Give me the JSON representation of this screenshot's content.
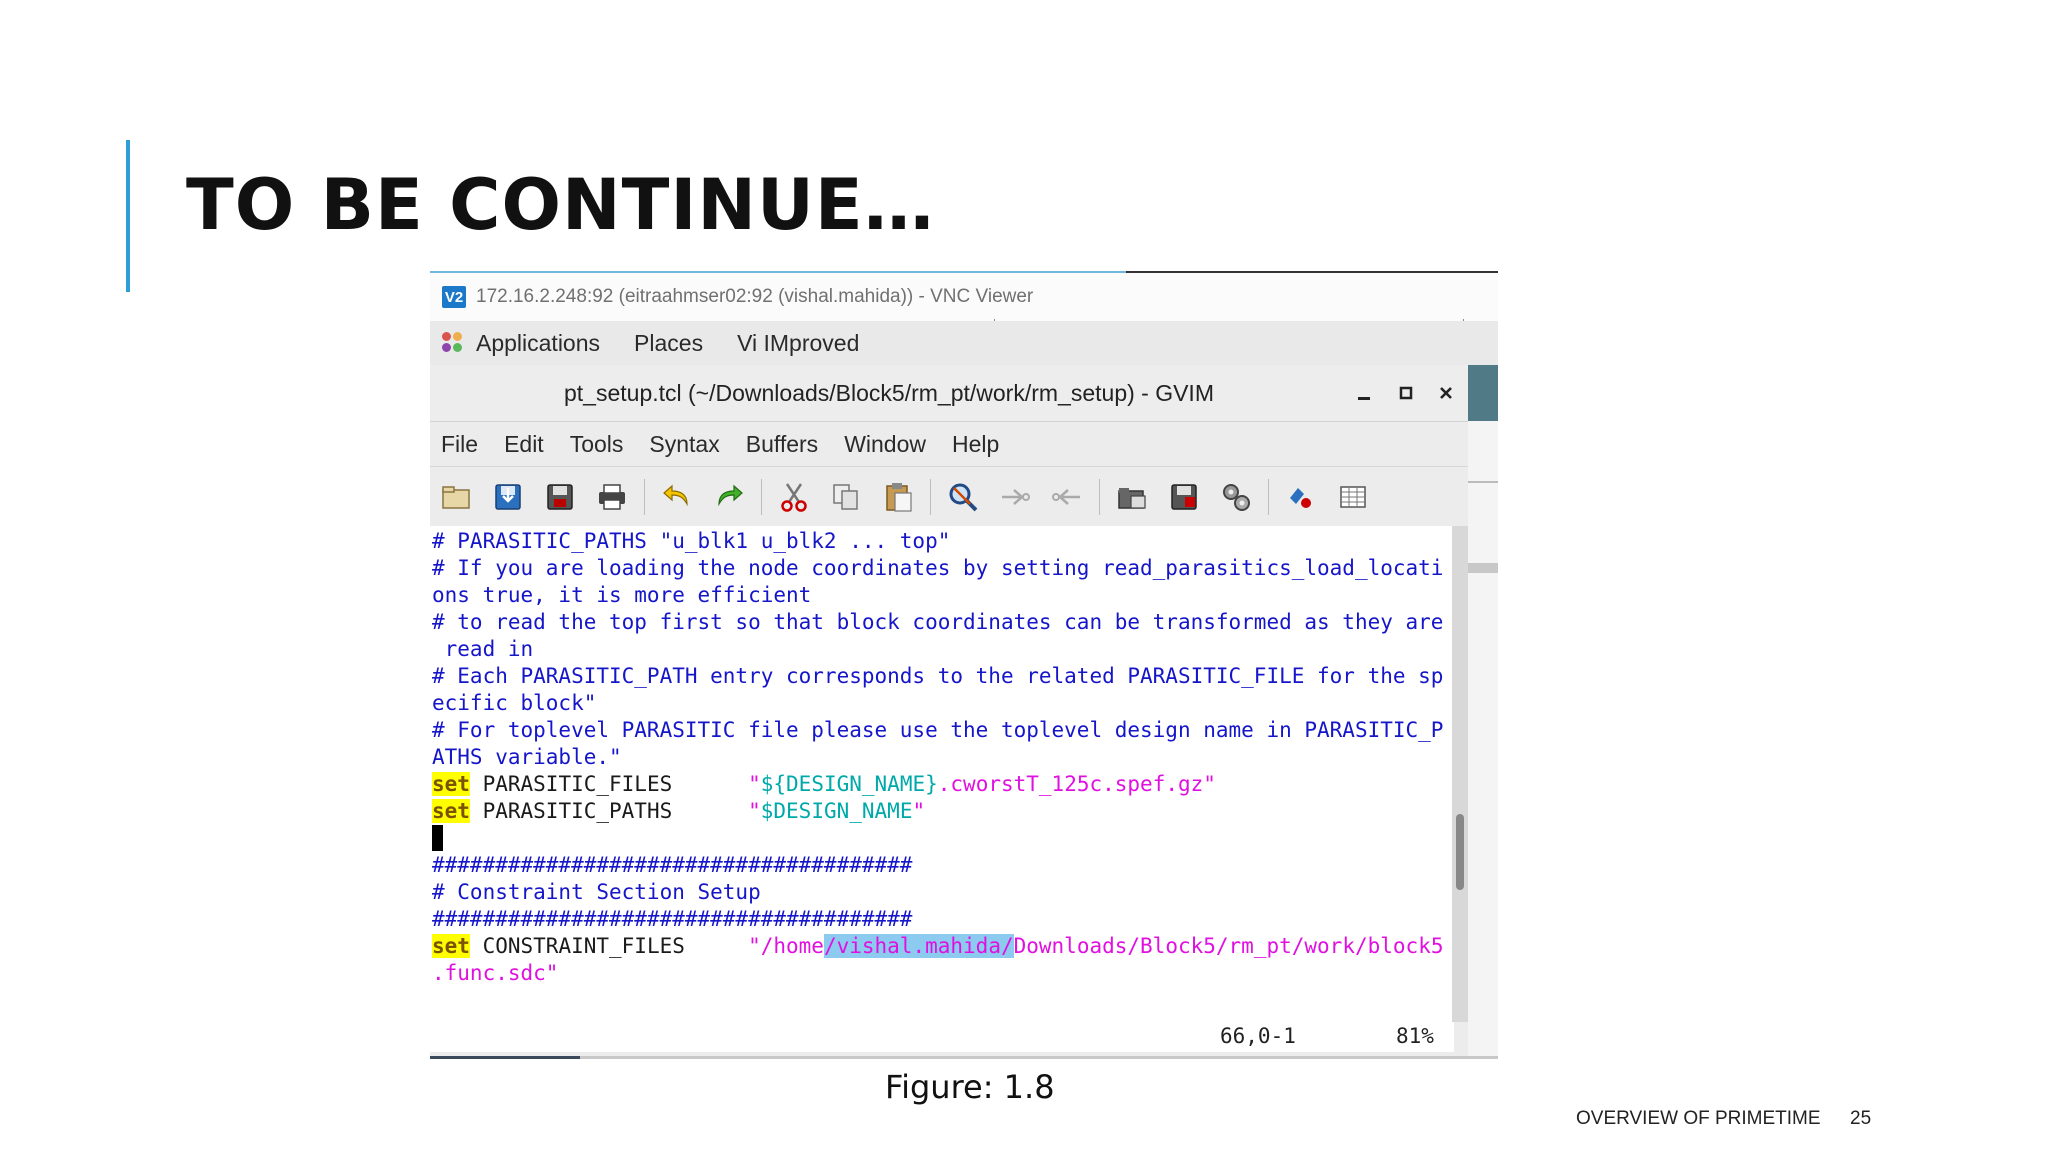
{
  "slide": {
    "title": "TO BE CONTINUE…",
    "caption": "Figure: 1.8",
    "footer": "OVERVIEW OF PRIMETIME",
    "page_number": "25",
    "accent_color": "#2e9fd6"
  },
  "vnc": {
    "logo": "V2",
    "title": "172.16.2.248:92 (eitraahmser02:92 (vishal.mahida)) - VNC Viewer"
  },
  "gnome_panel": {
    "applications": "Applications",
    "places": "Places",
    "vim": "Vi IMproved"
  },
  "gvim": {
    "title": "pt_setup.tcl (~/Downloads/Block5/rm_pt/work/rm_setup) - GVIM",
    "menu": [
      "File",
      "Edit",
      "Tools",
      "Syntax",
      "Buffers",
      "Window",
      "Help"
    ],
    "toolbar_icons": [
      "open-file-icon",
      "save-icon",
      "save-all-icon",
      "print-icon",
      "undo-icon",
      "redo-icon",
      "cut-icon",
      "copy-icon",
      "paste-icon",
      "find-replace-icon",
      "find-next-icon",
      "find-previous-icon",
      "load-session-icon",
      "save-session-icon",
      "run-script-icon",
      "make-icon",
      "tag-icon"
    ],
    "lines": {
      "l1": "# PARASITIC_PATHS \"u_blk1 u_blk2 ... top\"",
      "l2": "# If you are loading the node coordinates by setting read_parasitics_load_locati",
      "l3": "ons true, it is more efficient",
      "l4": "# to read the top first so that block coordinates can be transformed as they are",
      "l5": " read in",
      "l6": "# Each PARASITIC_PATH entry corresponds to the related PARASITIC_FILE for the sp",
      "l7": "ecific block\"",
      "l8": "# For toplevel PARASITIC file please use the toplevel design name in PARASITIC_P",
      "l9": "ATHS variable.\"",
      "kw": "set",
      "l10_name": " PARASITIC_FILES      ",
      "l10_q1": "\"",
      "l10_var": "${DESIGN_NAME}",
      "l10_rest": ".cworstT_125c.spef.gz\"",
      "l11_name": " PARASITIC_PATHS      ",
      "l11_q1": "\"",
      "l11_var": "$DESIGN_NAME",
      "l11_q2": "\"",
      "l13": "######################################",
      "l14": "# Constraint Section Setup",
      "l15": "######################################",
      "l16_name": " CONSTRAINT_FILES     ",
      "l16_pre": "\"/home",
      "l16_sel": "/vishal.mahida/",
      "l16_post": "Downloads/Block5/rm_pt/work/block5",
      "l17": ".func.sdc\""
    },
    "status_position": "66,0-1",
    "status_percent": "81%"
  }
}
